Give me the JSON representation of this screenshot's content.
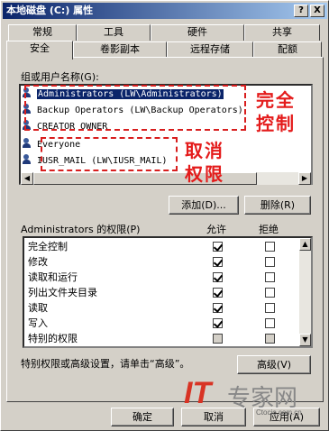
{
  "window": {
    "title": "本地磁盘 (C:) 属性",
    "help_label": "?",
    "close_label": "X"
  },
  "tabs_row1": [
    "常规",
    "工具",
    "硬件",
    "共享"
  ],
  "tabs_row2": [
    "安全",
    "卷影副本",
    "远程存储",
    "配额"
  ],
  "active_tab": "安全",
  "groups": {
    "label": "组或用户名称(G):",
    "items": [
      "Administrators (LW\\Administrators)",
      "Backup Operators (LW\\Backup Operators)",
      "CREATOR OWNER",
      "Everyone",
      "IUSR_MAIL (LW\\IUSR_MAIL)"
    ],
    "selected_index": 0
  },
  "annotations": {
    "full_control_line1": "完全",
    "full_control_line2": "控制",
    "remove_line1": "取消",
    "remove_line2": "权限"
  },
  "buttons": {
    "add": "添加(D)...",
    "remove": "删除(R)",
    "advanced": "高级(V)",
    "ok": "确定",
    "cancel": "取消",
    "apply": "应用(A)"
  },
  "permissions": {
    "title": "Administrators 的权限(P)",
    "allow_header": "允许",
    "deny_header": "拒绝",
    "rows": [
      {
        "name": "完全控制",
        "allow": true,
        "deny": false
      },
      {
        "name": "修改",
        "allow": true,
        "deny": false
      },
      {
        "name": "读取和运行",
        "allow": true,
        "deny": false
      },
      {
        "name": "列出文件夹目录",
        "allow": true,
        "deny": false
      },
      {
        "name": "读取",
        "allow": true,
        "deny": false
      },
      {
        "name": "写入",
        "allow": true,
        "deny": false
      },
      {
        "name": "特别的权限",
        "allow": false,
        "deny": false
      }
    ]
  },
  "advanced_hint": "特别权限或高级设置，请单击“高级”。",
  "watermark": {
    "brand": "IT",
    "brand_cn": "专家网",
    "url": "Ctocio.com.cn"
  }
}
